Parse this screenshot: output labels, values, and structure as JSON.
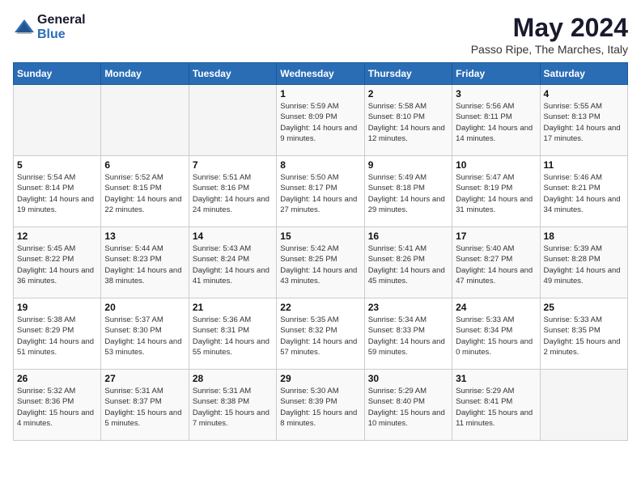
{
  "header": {
    "logo_general": "General",
    "logo_blue": "Blue",
    "month_year": "May 2024",
    "location": "Passo Ripe, The Marches, Italy"
  },
  "days_of_week": [
    "Sunday",
    "Monday",
    "Tuesday",
    "Wednesday",
    "Thursday",
    "Friday",
    "Saturday"
  ],
  "weeks": [
    [
      {
        "day": "",
        "sunrise": "",
        "sunset": "",
        "daylight": ""
      },
      {
        "day": "",
        "sunrise": "",
        "sunset": "",
        "daylight": ""
      },
      {
        "day": "",
        "sunrise": "",
        "sunset": "",
        "daylight": ""
      },
      {
        "day": "1",
        "sunrise": "Sunrise: 5:59 AM",
        "sunset": "Sunset: 8:09 PM",
        "daylight": "Daylight: 14 hours and 9 minutes."
      },
      {
        "day": "2",
        "sunrise": "Sunrise: 5:58 AM",
        "sunset": "Sunset: 8:10 PM",
        "daylight": "Daylight: 14 hours and 12 minutes."
      },
      {
        "day": "3",
        "sunrise": "Sunrise: 5:56 AM",
        "sunset": "Sunset: 8:11 PM",
        "daylight": "Daylight: 14 hours and 14 minutes."
      },
      {
        "day": "4",
        "sunrise": "Sunrise: 5:55 AM",
        "sunset": "Sunset: 8:13 PM",
        "daylight": "Daylight: 14 hours and 17 minutes."
      }
    ],
    [
      {
        "day": "5",
        "sunrise": "Sunrise: 5:54 AM",
        "sunset": "Sunset: 8:14 PM",
        "daylight": "Daylight: 14 hours and 19 minutes."
      },
      {
        "day": "6",
        "sunrise": "Sunrise: 5:52 AM",
        "sunset": "Sunset: 8:15 PM",
        "daylight": "Daylight: 14 hours and 22 minutes."
      },
      {
        "day": "7",
        "sunrise": "Sunrise: 5:51 AM",
        "sunset": "Sunset: 8:16 PM",
        "daylight": "Daylight: 14 hours and 24 minutes."
      },
      {
        "day": "8",
        "sunrise": "Sunrise: 5:50 AM",
        "sunset": "Sunset: 8:17 PM",
        "daylight": "Daylight: 14 hours and 27 minutes."
      },
      {
        "day": "9",
        "sunrise": "Sunrise: 5:49 AM",
        "sunset": "Sunset: 8:18 PM",
        "daylight": "Daylight: 14 hours and 29 minutes."
      },
      {
        "day": "10",
        "sunrise": "Sunrise: 5:47 AM",
        "sunset": "Sunset: 8:19 PM",
        "daylight": "Daylight: 14 hours and 31 minutes."
      },
      {
        "day": "11",
        "sunrise": "Sunrise: 5:46 AM",
        "sunset": "Sunset: 8:21 PM",
        "daylight": "Daylight: 14 hours and 34 minutes."
      }
    ],
    [
      {
        "day": "12",
        "sunrise": "Sunrise: 5:45 AM",
        "sunset": "Sunset: 8:22 PM",
        "daylight": "Daylight: 14 hours and 36 minutes."
      },
      {
        "day": "13",
        "sunrise": "Sunrise: 5:44 AM",
        "sunset": "Sunset: 8:23 PM",
        "daylight": "Daylight: 14 hours and 38 minutes."
      },
      {
        "day": "14",
        "sunrise": "Sunrise: 5:43 AM",
        "sunset": "Sunset: 8:24 PM",
        "daylight": "Daylight: 14 hours and 41 minutes."
      },
      {
        "day": "15",
        "sunrise": "Sunrise: 5:42 AM",
        "sunset": "Sunset: 8:25 PM",
        "daylight": "Daylight: 14 hours and 43 minutes."
      },
      {
        "day": "16",
        "sunrise": "Sunrise: 5:41 AM",
        "sunset": "Sunset: 8:26 PM",
        "daylight": "Daylight: 14 hours and 45 minutes."
      },
      {
        "day": "17",
        "sunrise": "Sunrise: 5:40 AM",
        "sunset": "Sunset: 8:27 PM",
        "daylight": "Daylight: 14 hours and 47 minutes."
      },
      {
        "day": "18",
        "sunrise": "Sunrise: 5:39 AM",
        "sunset": "Sunset: 8:28 PM",
        "daylight": "Daylight: 14 hours and 49 minutes."
      }
    ],
    [
      {
        "day": "19",
        "sunrise": "Sunrise: 5:38 AM",
        "sunset": "Sunset: 8:29 PM",
        "daylight": "Daylight: 14 hours and 51 minutes."
      },
      {
        "day": "20",
        "sunrise": "Sunrise: 5:37 AM",
        "sunset": "Sunset: 8:30 PM",
        "daylight": "Daylight: 14 hours and 53 minutes."
      },
      {
        "day": "21",
        "sunrise": "Sunrise: 5:36 AM",
        "sunset": "Sunset: 8:31 PM",
        "daylight": "Daylight: 14 hours and 55 minutes."
      },
      {
        "day": "22",
        "sunrise": "Sunrise: 5:35 AM",
        "sunset": "Sunset: 8:32 PM",
        "daylight": "Daylight: 14 hours and 57 minutes."
      },
      {
        "day": "23",
        "sunrise": "Sunrise: 5:34 AM",
        "sunset": "Sunset: 8:33 PM",
        "daylight": "Daylight: 14 hours and 59 minutes."
      },
      {
        "day": "24",
        "sunrise": "Sunrise: 5:33 AM",
        "sunset": "Sunset: 8:34 PM",
        "daylight": "Daylight: 15 hours and 0 minutes."
      },
      {
        "day": "25",
        "sunrise": "Sunrise: 5:33 AM",
        "sunset": "Sunset: 8:35 PM",
        "daylight": "Daylight: 15 hours and 2 minutes."
      }
    ],
    [
      {
        "day": "26",
        "sunrise": "Sunrise: 5:32 AM",
        "sunset": "Sunset: 8:36 PM",
        "daylight": "Daylight: 15 hours and 4 minutes."
      },
      {
        "day": "27",
        "sunrise": "Sunrise: 5:31 AM",
        "sunset": "Sunset: 8:37 PM",
        "daylight": "Daylight: 15 hours and 5 minutes."
      },
      {
        "day": "28",
        "sunrise": "Sunrise: 5:31 AM",
        "sunset": "Sunset: 8:38 PM",
        "daylight": "Daylight: 15 hours and 7 minutes."
      },
      {
        "day": "29",
        "sunrise": "Sunrise: 5:30 AM",
        "sunset": "Sunset: 8:39 PM",
        "daylight": "Daylight: 15 hours and 8 minutes."
      },
      {
        "day": "30",
        "sunrise": "Sunrise: 5:29 AM",
        "sunset": "Sunset: 8:40 PM",
        "daylight": "Daylight: 15 hours and 10 minutes."
      },
      {
        "day": "31",
        "sunrise": "Sunrise: 5:29 AM",
        "sunset": "Sunset: 8:41 PM",
        "daylight": "Daylight: 15 hours and 11 minutes."
      },
      {
        "day": "",
        "sunrise": "",
        "sunset": "",
        "daylight": ""
      }
    ]
  ]
}
